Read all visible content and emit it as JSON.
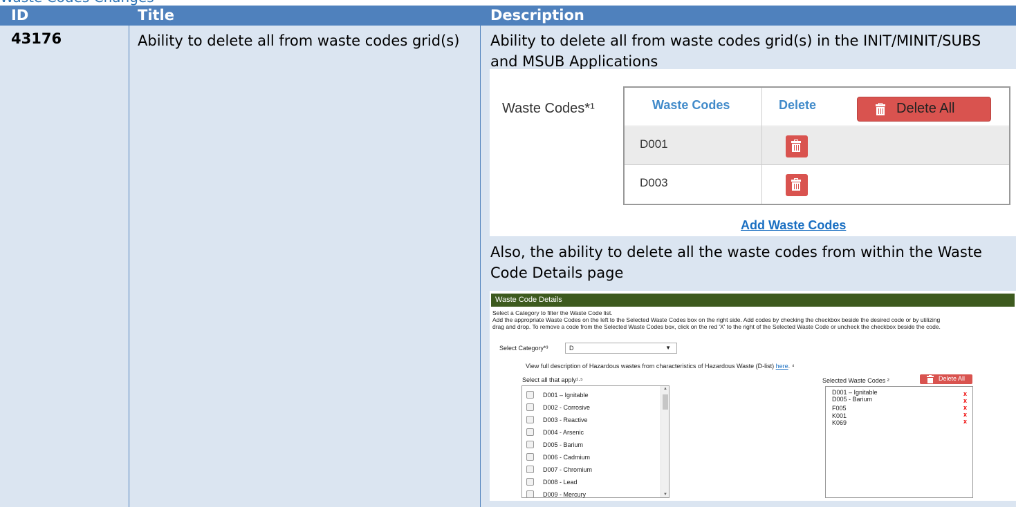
{
  "table": {
    "headers": {
      "id": "ID",
      "title": "Title",
      "description": "Description"
    },
    "row": {
      "id": "43176",
      "title": "Ability to delete all from waste codes grid(s)",
      "desc_intro": "Ability to delete all from waste codes grid(s) in the INIT/MINIT/SUBS and MSUB Applications",
      "desc_also": "Also, the ability to delete all the waste codes from within the Waste Code Details page"
    }
  },
  "grid_snippet": {
    "label": "Waste Codes*¹",
    "col_waste_codes": "Waste Codes",
    "col_delete": "Delete",
    "delete_all_label": "Delete All",
    "rows": [
      {
        "code": "D001"
      },
      {
        "code": "D003"
      }
    ],
    "add_link": "Add Waste Codes",
    "colors": {
      "danger": "#d9534f",
      "header_text": "#428bca",
      "alt_row": "#ebebeb"
    }
  },
  "details_snippet": {
    "title_bar": "Waste Code Details",
    "instructions": [
      "Select a Category to filter the Waste Code list.",
      "Add the appropriate Waste Codes on the left to the Selected Waste Codes box on the right side. Add codes by checking the checkbox beside the desired code or by utilizing",
      "drag and drop. To remove a code from the Selected Waste Codes box, click on the red 'X' to the right of the Selected Waste Code or uncheck the checkbox beside the code."
    ],
    "category_label": "Select Category*³",
    "category_value": "D",
    "view_text": "View full description of Hazardous wastes from characteristics of Hazardous Waste (D-list)",
    "view_link": "here",
    "view_suffix": ". ⁴",
    "select_all_label": "Select all that apply¹·⁵",
    "available_codes": [
      "D001 – Ignitable",
      "D002 - Corrosive",
      "D003 - Reactive",
      "D004 - Arsenic",
      "D005 - Barium",
      "D006 - Cadmium",
      "D007 - Chromium",
      "D008 - Lead",
      "D009 - Mercury"
    ],
    "selected_label": "Selected Waste Codes ²",
    "delete_all_label": "Delete All",
    "selected_codes": [
      "D001 – Ignitable",
      "D005 - Barium",
      "F005",
      "K001",
      "K069"
    ],
    "remove_mark": "x",
    "colors": {
      "title_bar": "#3d5a1e",
      "remove": "#ee0000"
    }
  },
  "colors": {
    "header_bg": "#4f81bd",
    "row_bg": "#dbe5f1"
  }
}
